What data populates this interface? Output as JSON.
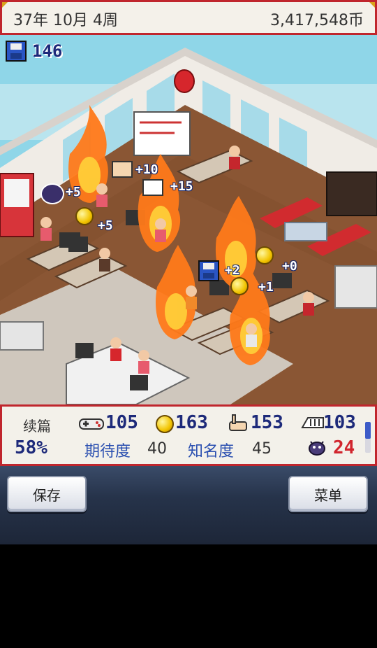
{
  "header": {
    "date": "37年 10月 4周",
    "money": "3,417,548币"
  },
  "scene": {
    "save_count": "146",
    "floats": {
      "plus5_a": "+5",
      "plus5_b": "+5",
      "plus10": "+10",
      "plus15": "+15",
      "plus2": "+2",
      "plus0": "+0",
      "plus1": "+1"
    }
  },
  "stats": {
    "genre": "续篇",
    "progress": "58%",
    "fun": "105",
    "creativity": "163",
    "graphics": "153",
    "sound": "103",
    "expectation_label": "期待度",
    "expectation_value": "40",
    "fame_label": "知名度",
    "fame_value": "45",
    "bugs": "24"
  },
  "buttons": {
    "save": "保存",
    "menu": "菜单"
  },
  "colors": {
    "frame_red": "#c0262d",
    "stat_blue": "#1d2a7a",
    "bug_red": "#d1252d"
  }
}
